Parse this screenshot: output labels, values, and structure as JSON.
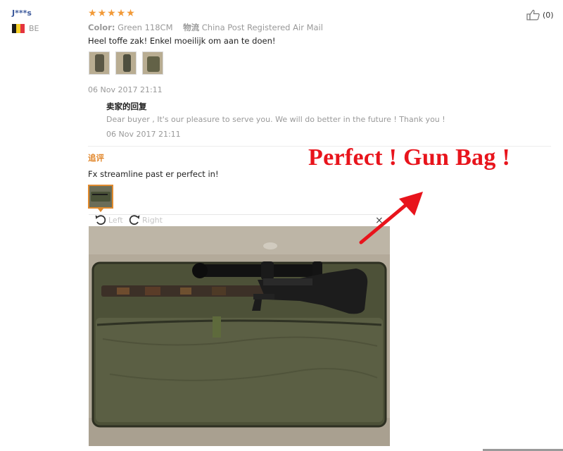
{
  "user": {
    "name": "J***s",
    "country": "BE"
  },
  "review": {
    "stars": [
      "★",
      "★",
      "★",
      "★",
      "★"
    ],
    "color_label": "Color:",
    "color_value": "Green 118CM",
    "logistics_label": "物流",
    "logistics_value": "China Post Registered Air Mail",
    "text": "Heel toffe zak! Enkel moeilijk om aan te doen!",
    "date": "06 Nov 2017 21:11",
    "like_count": "(0)"
  },
  "seller_reply": {
    "title": "卖家的回复",
    "text": "Dear buyer , It's our pleasure to serve you. We will do better in the future ! Thank you !",
    "date": "06 Nov 2017 21:11"
  },
  "followup": {
    "title": "追评",
    "text": "Fx streamline past er perfect in!"
  },
  "viewer": {
    "left_label": "Left",
    "right_label": "Right",
    "close": "×"
  },
  "annotation": {
    "text": "Perfect ! Gun Bag !"
  },
  "colors": {
    "star": "#f29a38",
    "annotation": "#e8141c",
    "followup": "#e1862a",
    "username": "#3d5a9c"
  },
  "icons": [
    "flag-be-icon",
    "thumbs-up-icon",
    "rotate-left-icon",
    "rotate-right-icon",
    "close-icon",
    "arrow-annotation-icon"
  ]
}
